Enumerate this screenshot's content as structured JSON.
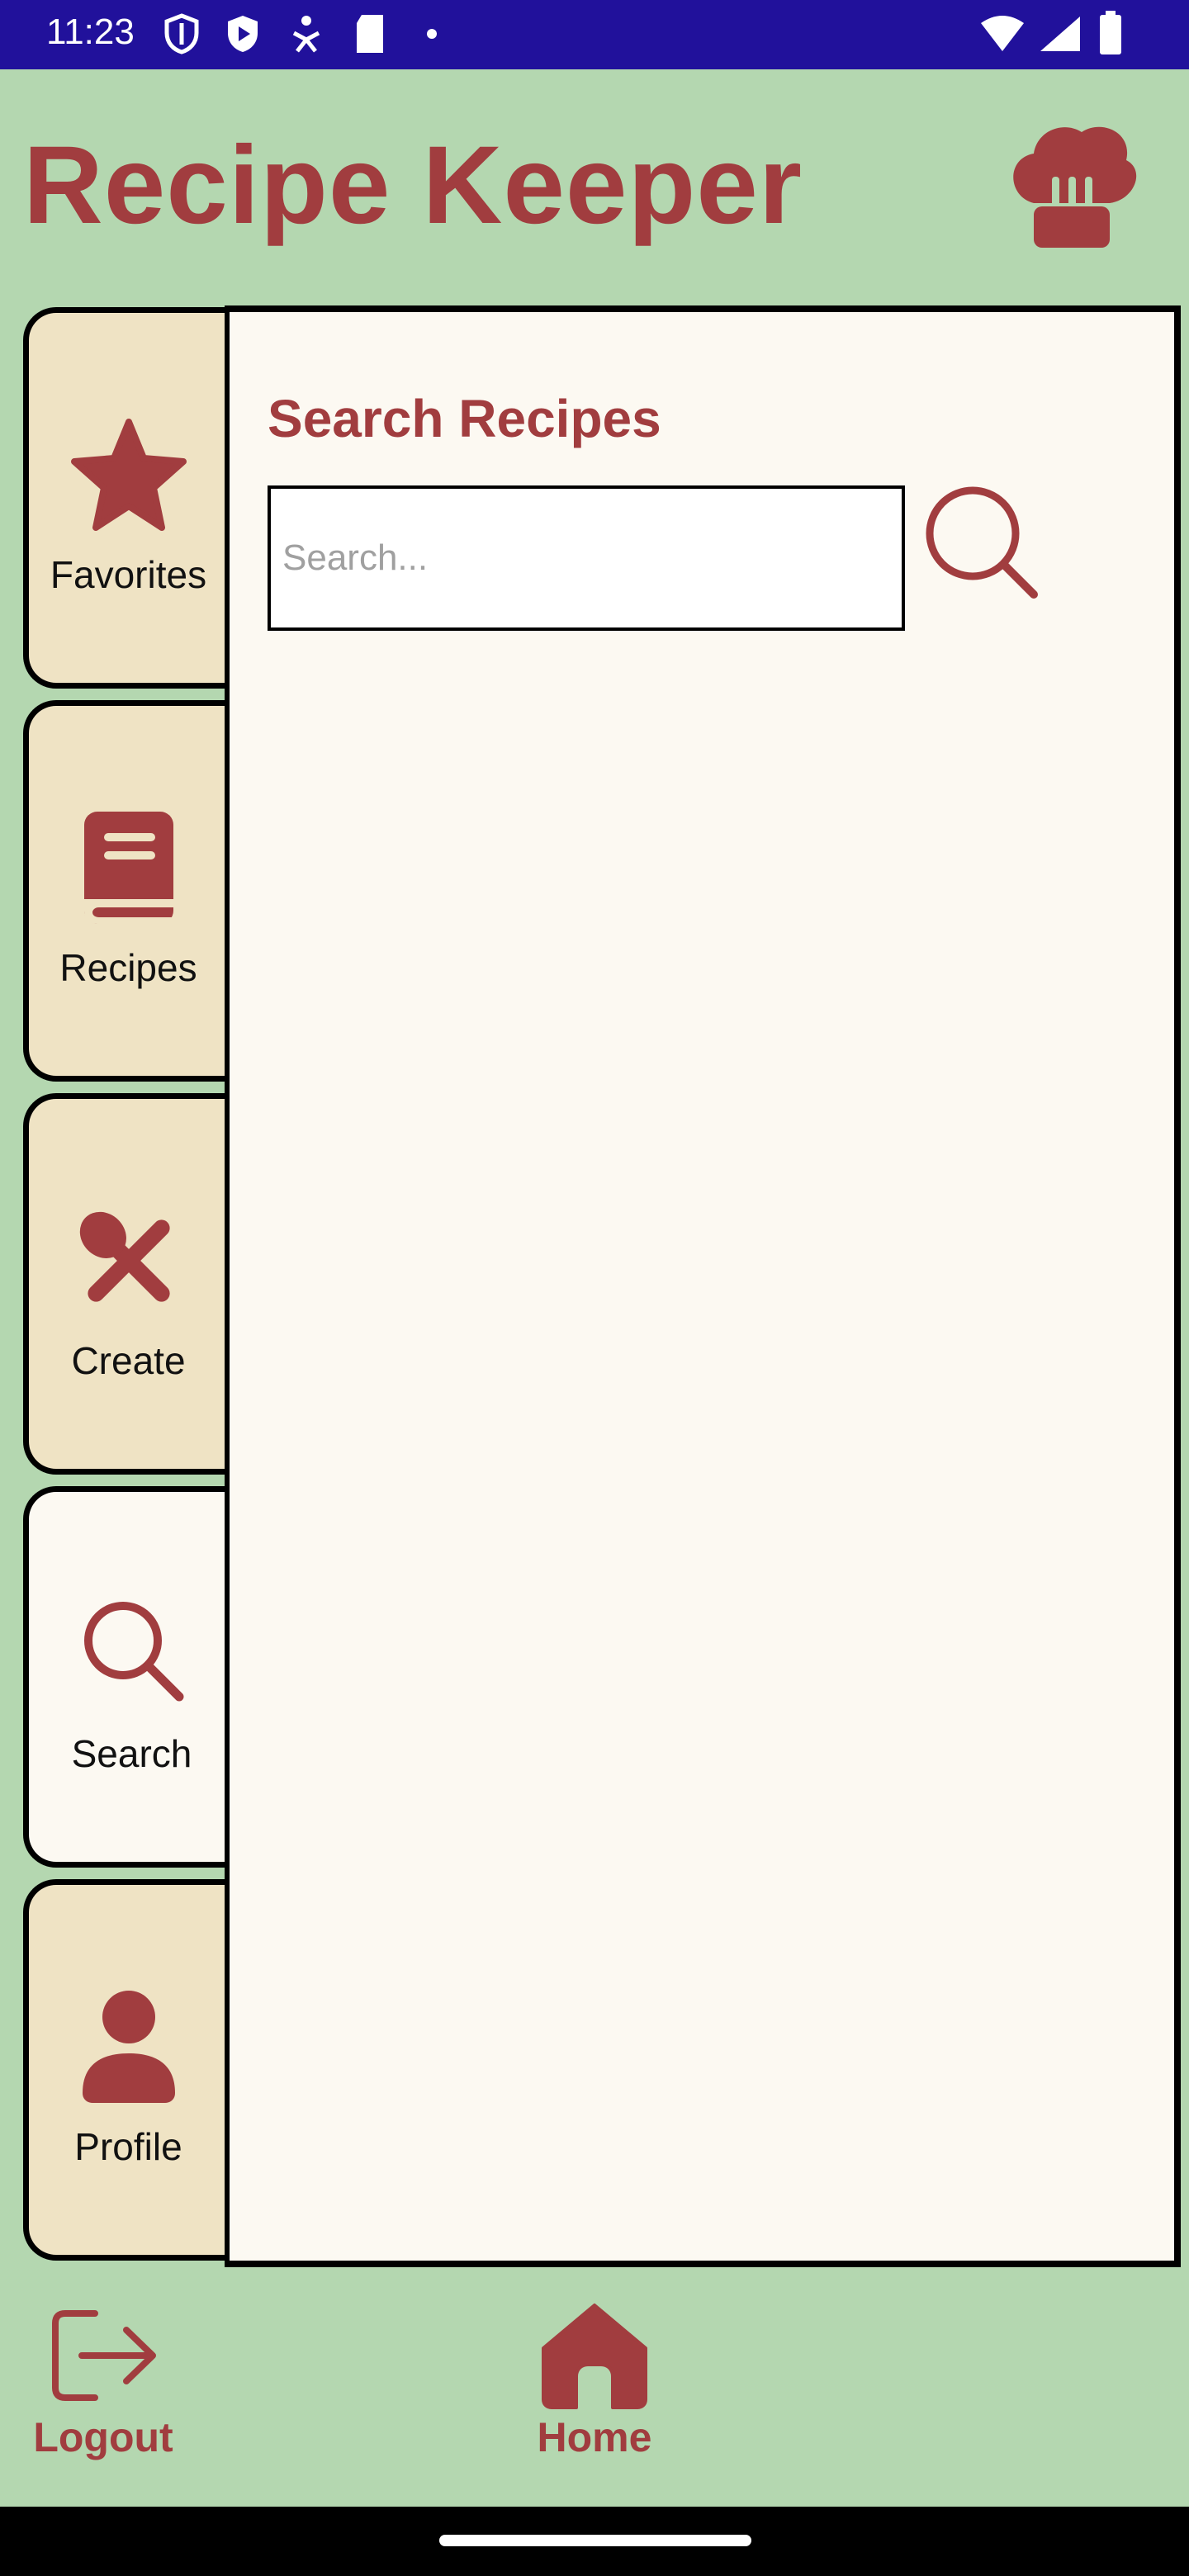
{
  "status_bar": {
    "time": "11:23"
  },
  "app": {
    "title": "Recipe Keeper"
  },
  "panel": {
    "title": "Search Recipes",
    "search_placeholder": "Search...",
    "search_value": ""
  },
  "tabs": [
    {
      "id": "favorites",
      "label": "Favorites",
      "icon": "star-icon"
    },
    {
      "id": "recipes",
      "label": "Recipes",
      "icon": "book-icon"
    },
    {
      "id": "create",
      "label": "Create",
      "icon": "utensils-icon"
    },
    {
      "id": "search",
      "label": "Search",
      "icon": "search-icon",
      "active": true
    },
    {
      "id": "profile",
      "label": "Profile",
      "icon": "user-icon"
    }
  ],
  "bottom_nav": [
    {
      "label": "Logout",
      "icon": "logout-icon"
    },
    {
      "label": "Home",
      "icon": "home-icon"
    }
  ],
  "colors": {
    "accent": "#a13d3f",
    "background": "#b4d7b0",
    "tab_bg": "#efe3c4",
    "panel_bg": "#fcf9f2",
    "status_bar": "#21119b"
  }
}
